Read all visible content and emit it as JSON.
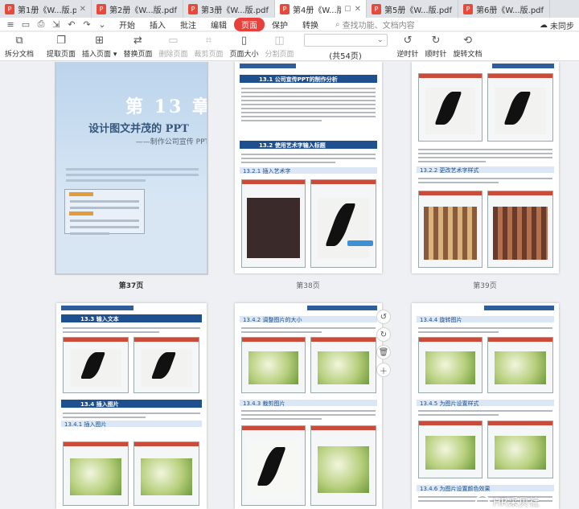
{
  "tabs": [
    {
      "title": "第1册《W...版.pdf",
      "active": false
    },
    {
      "title": "第2册《W...版.pdf",
      "active": false
    },
    {
      "title": "第3册《W...版.pdf",
      "active": false
    },
    {
      "title": "第4册《W...版.pdf",
      "active": true
    },
    {
      "title": "第5册《W...版.pdf",
      "active": false
    },
    {
      "title": "第6册《W...版.pdf",
      "active": false
    }
  ],
  "menu": {
    "items": [
      "开始",
      "插入",
      "批注",
      "编辑",
      "页面",
      "保护",
      "转换"
    ],
    "active": "页面",
    "search_hint": "查找功能、文档内容",
    "right_label": "未同步"
  },
  "toolbar": {
    "split": "拆分文档",
    "extract": "提取页面",
    "insert": "插入页面",
    "replace": "替换页面",
    "delete": "删除页面",
    "crop": "裁剪页面",
    "page_size": "页面大小",
    "split_page": "分割页面",
    "page_count": "(共54页)",
    "rotate_ccw": "逆时针",
    "rotate_cw": "顺时针",
    "rotate_doc": "旋转文档"
  },
  "pages": {
    "p37": {
      "label": "第37页",
      "chapter": "第 13 章",
      "title": "设计图文并茂的 PPT",
      "subtitle": "——制作公司宣传 PPT"
    },
    "p38": {
      "label": "第38页",
      "s1": "13.1  公司宣传PPT的制作分析",
      "s2": "13.2  使用艺术字输入标题",
      "sub1": "13.2.1  插入艺术字"
    },
    "p39": {
      "label": "第39页",
      "sub1": "13.2.2  更改艺术字样式"
    },
    "p40": {
      "s1": "13.3  输入文本",
      "sub1": "13.3.1  输入标题",
      "s2": "13.4  插入图片",
      "sub2": "13.4.1  插入图片"
    },
    "p41": {
      "sub1": "13.4.2  调整图片的大小",
      "sub2": "13.4.3  裁剪图片"
    },
    "p42": {
      "sub1": "13.4.4  旋转图片",
      "sub2": "13.4.5  为图片设置样式",
      "sub3": "13.4.6  为图片设置颜色效果"
    }
  },
  "watermark": "HR采贝社"
}
